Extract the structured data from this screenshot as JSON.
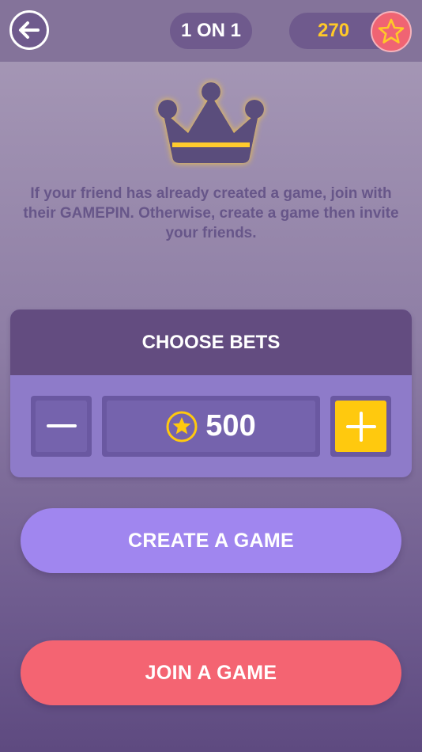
{
  "header": {
    "back_icon": "arrow-left-icon",
    "mode_label": "1 ON 1",
    "coins": "270",
    "coin_icon": "star-icon"
  },
  "hero": {
    "icon": "crown-icon",
    "intro_text": "If your friend has already created a game, join with their GAMEPIN. Otherwise, create a game then invite your friends."
  },
  "bets": {
    "title": "CHOOSE BETS",
    "amount": "500",
    "decrease_icon": "minus-icon",
    "increase_icon": "plus-icon",
    "coin_icon": "star-coin-icon"
  },
  "actions": {
    "create_label": "CREATE A GAME",
    "join_label": "JOIN A GAME"
  },
  "colors": {
    "accent_yellow": "#ffc90e",
    "create_purple": "#a086ef",
    "join_red": "#f46472",
    "header_purple": "#634c80"
  }
}
